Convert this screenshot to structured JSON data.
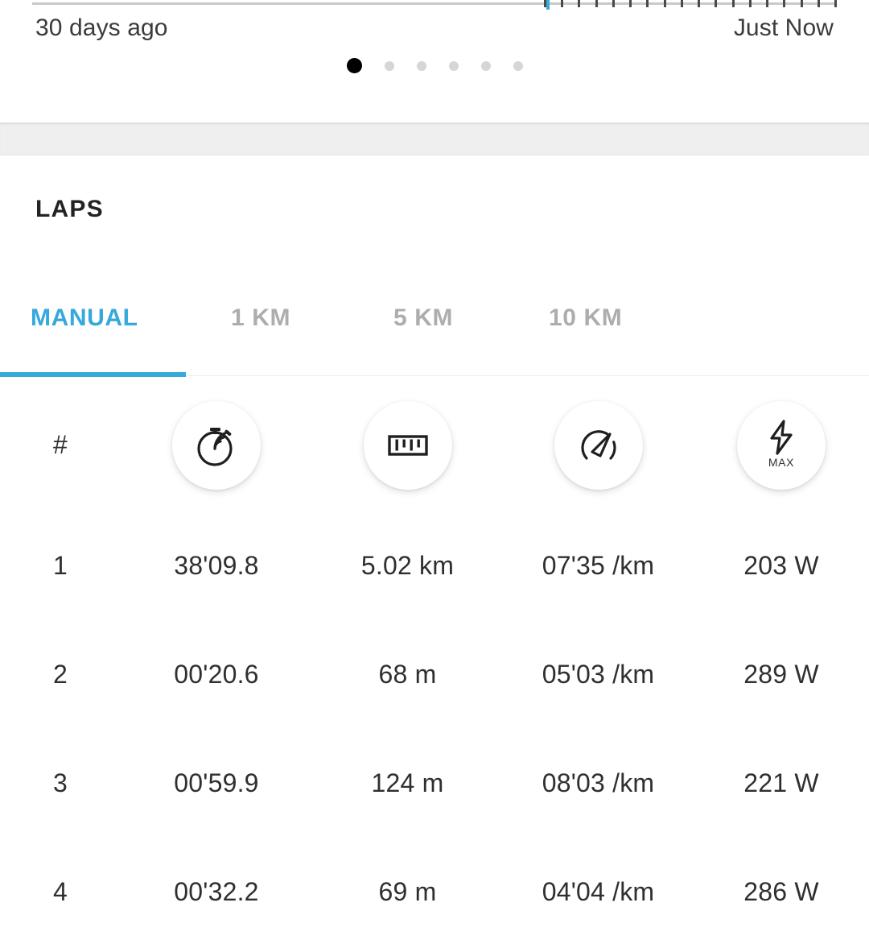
{
  "timeline": {
    "start_label": "30 days ago",
    "end_label": "Just Now",
    "marker_color": "#3aa9d6",
    "pager": {
      "total": 6,
      "active_index": 0
    }
  },
  "section": {
    "title": "LAPS"
  },
  "tabs": {
    "active_index": 0,
    "active_color": "#35a8dc",
    "inactive_color": "#adadad",
    "items": [
      {
        "label": "MANUAL"
      },
      {
        "label": "1 KM"
      },
      {
        "label": "5 KM"
      },
      {
        "label": "10 KM"
      }
    ]
  },
  "table": {
    "columns": [
      {
        "key": "index",
        "label": "#",
        "icon": "hash-symbol"
      },
      {
        "key": "duration",
        "label": "",
        "icon": "stopwatch-icon"
      },
      {
        "key": "distance",
        "label": "",
        "icon": "ruler-icon"
      },
      {
        "key": "pace",
        "label": "",
        "icon": "speedometer-icon"
      },
      {
        "key": "power",
        "label": "MAX",
        "icon": "lightning-bolt-icon"
      }
    ],
    "rows": [
      {
        "index": "1",
        "duration": "38'09.8",
        "distance": "5.02 km",
        "pace": "07'35 /km",
        "power": "203 W"
      },
      {
        "index": "2",
        "duration": "00'20.6",
        "distance": "68 m",
        "pace": "05'03 /km",
        "power": "289 W"
      },
      {
        "index": "3",
        "duration": "00'59.9",
        "distance": "124 m",
        "pace": "08'03 /km",
        "power": "221 W"
      },
      {
        "index": "4",
        "duration": "00'32.2",
        "distance": "69 m",
        "pace": "04'04 /km",
        "power": "286 W"
      }
    ]
  }
}
